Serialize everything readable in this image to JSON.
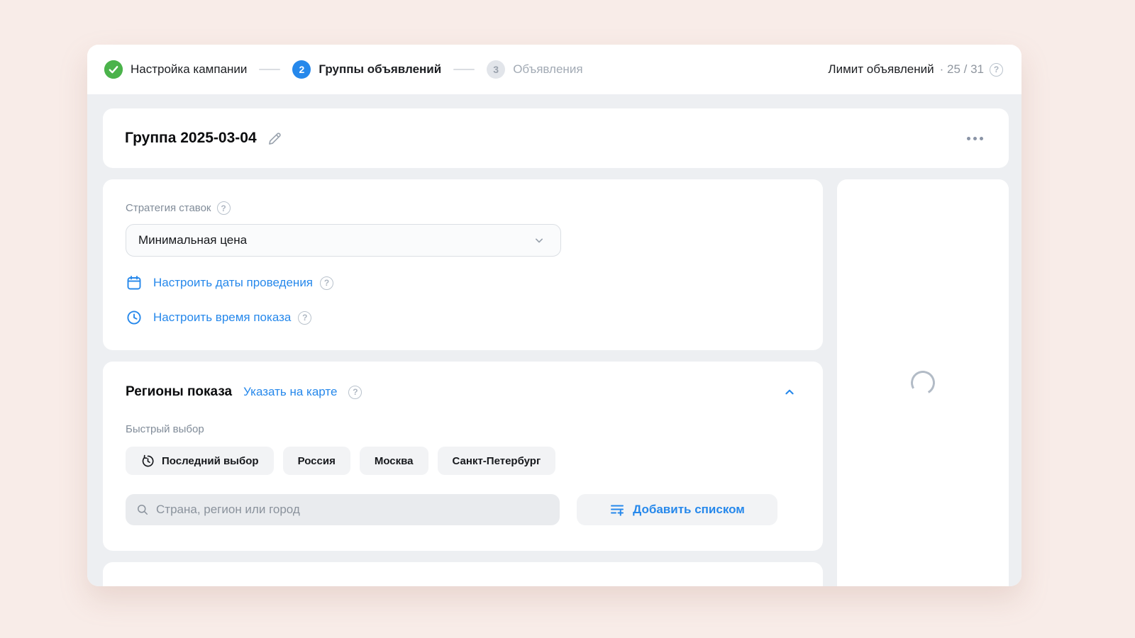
{
  "colors": {
    "accent_blue": "#2688eb",
    "success_green": "#4bb34b",
    "page_background": "#f8ece8",
    "content_background": "#edeff2",
    "muted_text": "#818c99"
  },
  "stepper": {
    "steps": [
      {
        "label": "Настройка кампании",
        "state": "done"
      },
      {
        "label": "Группы объявлений",
        "state": "active",
        "number": "2"
      },
      {
        "label": "Объявления",
        "state": "upcoming",
        "number": "3"
      }
    ],
    "limit_label": "Лимит объявлений",
    "limit_value": "· 25 / 31"
  },
  "group": {
    "title": "Группа 2025-03-04"
  },
  "strategy": {
    "label": "Стратегия ставок",
    "select_value": "Минимальная цена",
    "dates_link": "Настроить даты проведения",
    "time_link": "Настроить время показа"
  },
  "regions": {
    "title": "Регионы показа",
    "map_link": "Указать на карте",
    "quick_label": "Быстрый выбор",
    "chips": [
      "Последний выбор",
      "Россия",
      "Москва",
      "Санкт-Петербург"
    ],
    "search_placeholder": "Страна, регион или город",
    "add_list_button": "Добавить списком"
  },
  "icons": {
    "step_done": "check-circle",
    "group_edit": "pencil",
    "group_menu": "ellipsis",
    "hint": "help-circle",
    "dates": "calendar",
    "time": "clock",
    "select": "chevron-down",
    "collapse": "chevron-up",
    "recent": "history",
    "search": "magnifier",
    "add_list": "list-plus",
    "loading": "spinner"
  }
}
